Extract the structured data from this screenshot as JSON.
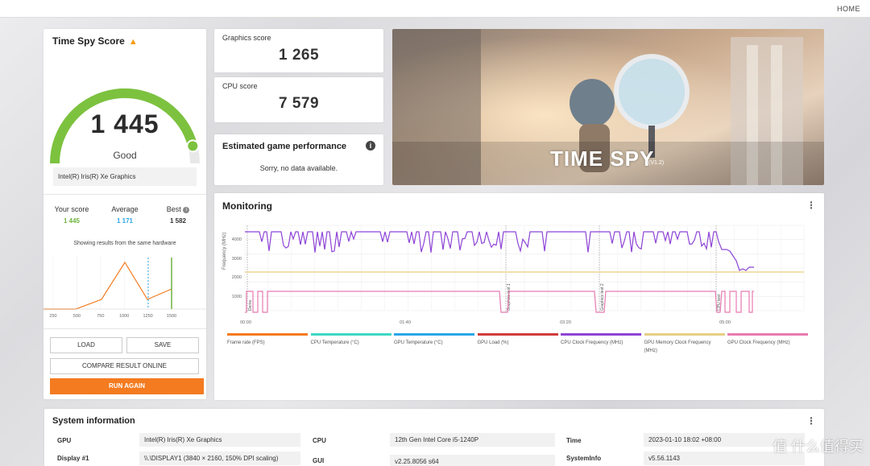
{
  "topbar": {
    "home": "HOME"
  },
  "score_card": {
    "title": "Time Spy Score",
    "score": "1 445",
    "rating": "Good",
    "gpu": "Intel(R) Iris(R) Xe Graphics",
    "gauge_fraction": 0.92,
    "compare": {
      "your_label": "Your score",
      "your_value": "1 445",
      "avg_label": "Average",
      "avg_value": "1 171",
      "best_label": "Best",
      "best_value": "1 582"
    },
    "same_hw_text": "Showing results from the same hardware",
    "buttons": {
      "load": "LOAD",
      "save": "SAVE",
      "compare": "COMPARE RESULT ONLINE",
      "run": "RUN AGAIN"
    }
  },
  "distribution_chart": {
    "x_ticks": [
      "250",
      "500",
      "750",
      "1000",
      "1250",
      "1500"
    ],
    "your_score": 1445,
    "average": 1171
  },
  "graphics_score": {
    "label": "Graphics score",
    "value": "1 265"
  },
  "cpu_score": {
    "label": "CPU score",
    "value": "7 579"
  },
  "game_perf": {
    "title": "Estimated game performance",
    "body": "Sorry, no data available."
  },
  "hero": {
    "title": "TIME SPY",
    "version": "(V1.2)"
  },
  "monitoring": {
    "title": "Monitoring",
    "y_label": "Frequency (MHz)",
    "y_ticks": [
      "4000",
      "3000",
      "2000",
      "1000"
    ],
    "x_ticks": [
      "00:00",
      "01:40",
      "03:20",
      "05:00"
    ],
    "markers": [
      "Demo",
      "Graphics test 1",
      "Graphics test 2",
      "CPU test"
    ],
    "legend": [
      {
        "label": "Frame rate (FPS)",
        "color": "#f47b20"
      },
      {
        "label": "CPU Temperature (°C)",
        "color": "#3ed8c3"
      },
      {
        "label": "GPU Temperature (°C)",
        "color": "#2aa6e8"
      },
      {
        "label": "GPU Load (%)",
        "color": "#d33b3b"
      },
      {
        "label": "CPU Clock Frequency (MHz)",
        "color": "#8e44d6"
      },
      {
        "label": "GPU Memory Clock Frequency (MHz)",
        "color": "#e6cf84"
      },
      {
        "label": "GPU Clock Frequency (MHz)",
        "color": "#e87ab0"
      }
    ]
  },
  "system_info": {
    "title": "System information",
    "rows": [
      {
        "k1": "GPU",
        "v1": "Intel(R) Iris(R) Xe Graphics",
        "k2": "CPU",
        "v2": "12th Gen Intel Core i5-1240P",
        "k3": "Time",
        "v3": "2023-01-10 18:02 +08:00"
      },
      {
        "k1": "Display #1",
        "v1": "\\\\.\\DISPLAY1 (3840 × 2160, 150% DPI scaling)",
        "k2": "GUI",
        "v2": "v2.25.8056 s64",
        "k3": "SystemInfo",
        "v3": "v5.56.1143"
      }
    ]
  },
  "watermark": "值 什么值得买"
}
